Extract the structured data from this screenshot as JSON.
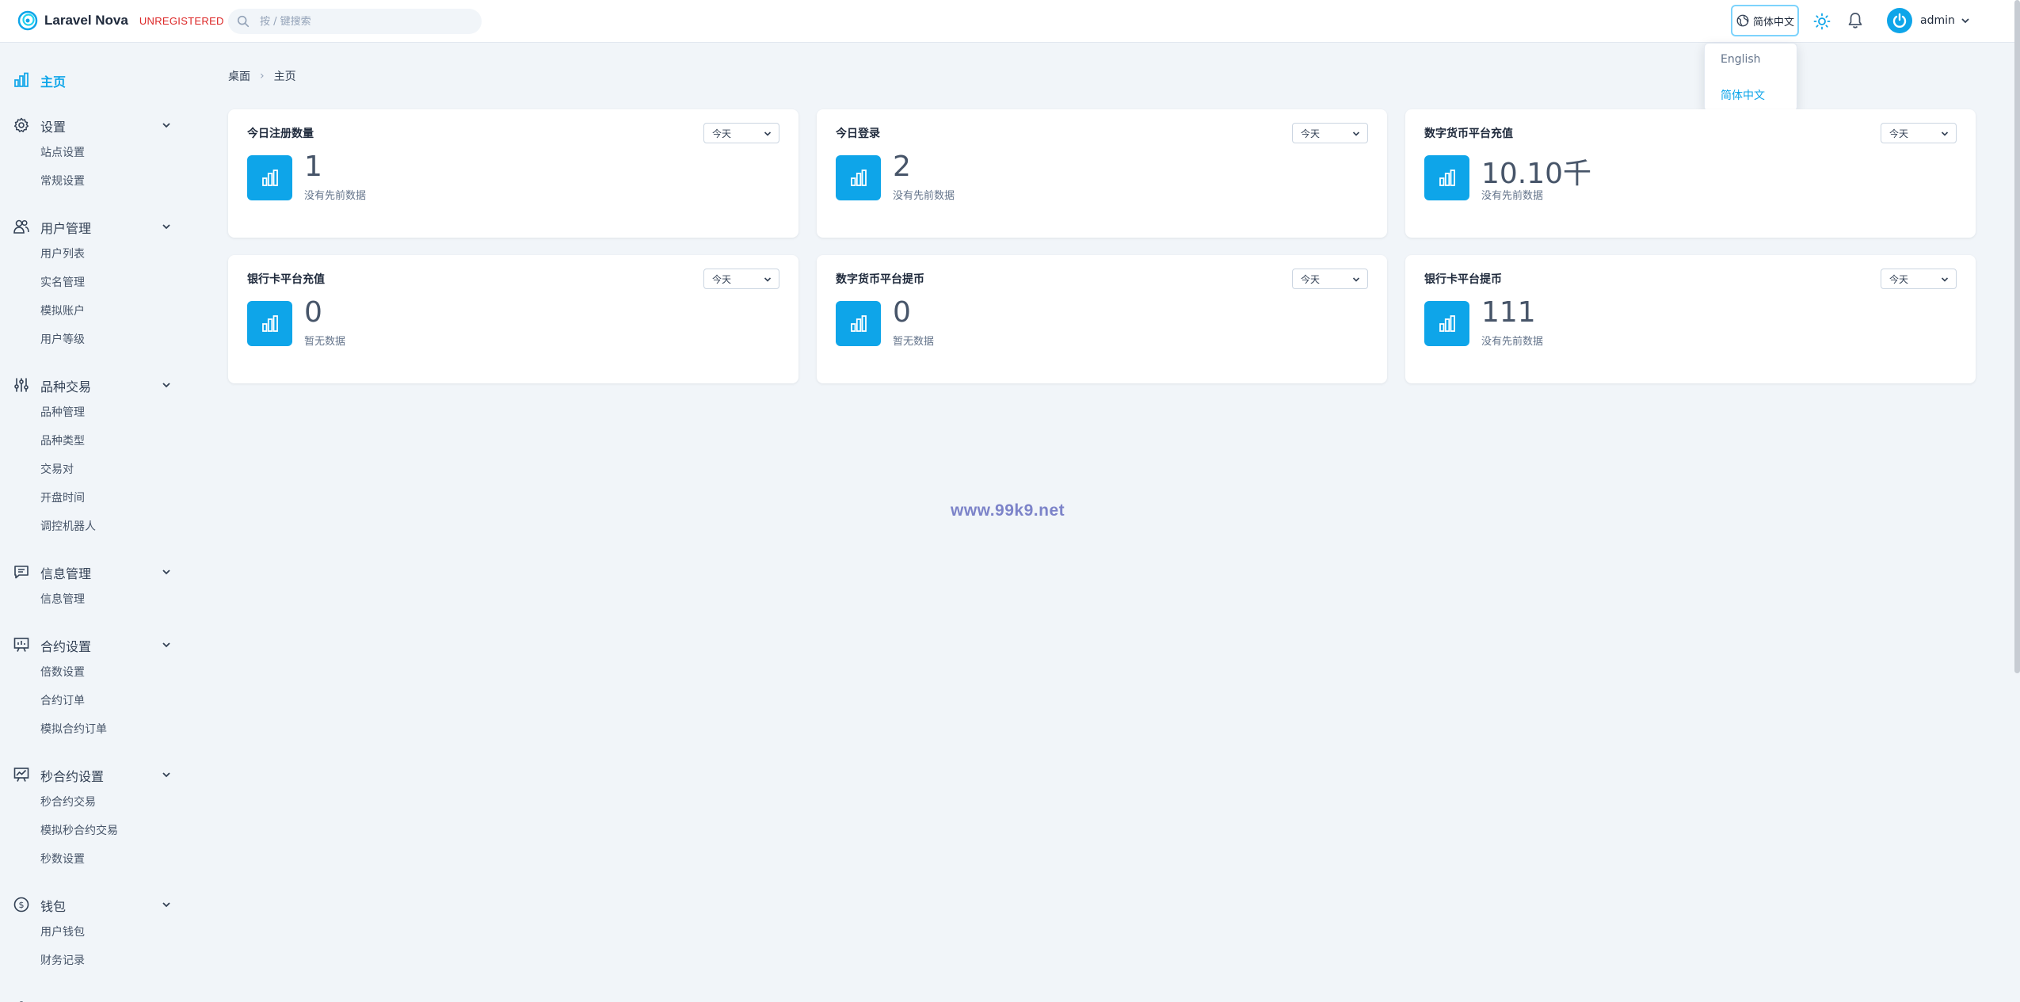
{
  "header": {
    "brand": "Laravel Nova",
    "license_badge": "UNREGISTERED",
    "search_placeholder": "按 / 键搜索",
    "language_button": "简体中文",
    "user_name": "admin"
  },
  "language_menu": {
    "items": [
      "English",
      "简体中文"
    ],
    "selected": "简体中文"
  },
  "sidebar": {
    "home": "主页",
    "groups": [
      {
        "label": "设置",
        "icon": "gear-icon",
        "items": [
          "站点设置",
          "常规设置"
        ]
      },
      {
        "label": "用户管理",
        "icon": "users-icon",
        "items": [
          "用户列表",
          "实名管理",
          "模拟账户",
          "用户等级"
        ]
      },
      {
        "label": "品种交易",
        "icon": "sliders-icon",
        "items": [
          "品种管理",
          "品种类型",
          "交易对",
          "开盘时间",
          "调控机器人"
        ]
      },
      {
        "label": "信息管理",
        "icon": "message-icon",
        "items": [
          "信息管理"
        ]
      },
      {
        "label": "合约设置",
        "icon": "presentation-icon",
        "items": [
          "倍数设置",
          "合约订单",
          "模拟合约订单"
        ]
      },
      {
        "label": "秒合约设置",
        "icon": "chart-board-icon",
        "items": [
          "秒合约交易",
          "模拟秒合约交易",
          "秒数设置"
        ]
      },
      {
        "label": "钱包",
        "icon": "dollar-icon",
        "items": [
          "用户钱包",
          "财务记录"
        ]
      }
    ]
  },
  "breadcrumb": [
    "桌面",
    "主页"
  ],
  "cards": [
    {
      "title": "今日注册数量",
      "range": "今天",
      "value": "1",
      "note": "没有先前数据"
    },
    {
      "title": "今日登录",
      "range": "今天",
      "value": "2",
      "note": "没有先前数据"
    },
    {
      "title": "数字货币平台充值",
      "range": "今天",
      "value": "10.10千",
      "note": "没有先前数据"
    },
    {
      "title": "银行卡平台充值",
      "range": "今天",
      "value": "0",
      "note": "暂无数据"
    },
    {
      "title": "数字货币平台提币",
      "range": "今天",
      "value": "0",
      "note": "暂无数据"
    },
    {
      "title": "银行卡平台提币",
      "range": "今天",
      "value": "111",
      "note": "没有先前数据"
    }
  ],
  "watermark": "www.99k9.net",
  "colors": {
    "accent": "#0ea5e9",
    "unregistered": "#dc2626"
  }
}
